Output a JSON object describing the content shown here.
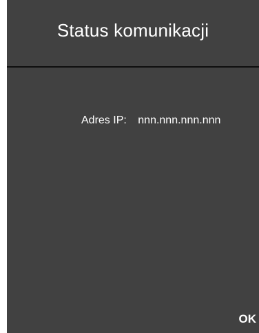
{
  "header": {
    "title": "Status komunikacji"
  },
  "status": {
    "ip_label": "Adres IP:",
    "ip_value": "nnn.nnn.nnn.nnn"
  },
  "footer": {
    "ok_label": "OK"
  },
  "colors": {
    "background": "#414141",
    "text": "#ffffff",
    "divider": "#0f0f0f"
  }
}
